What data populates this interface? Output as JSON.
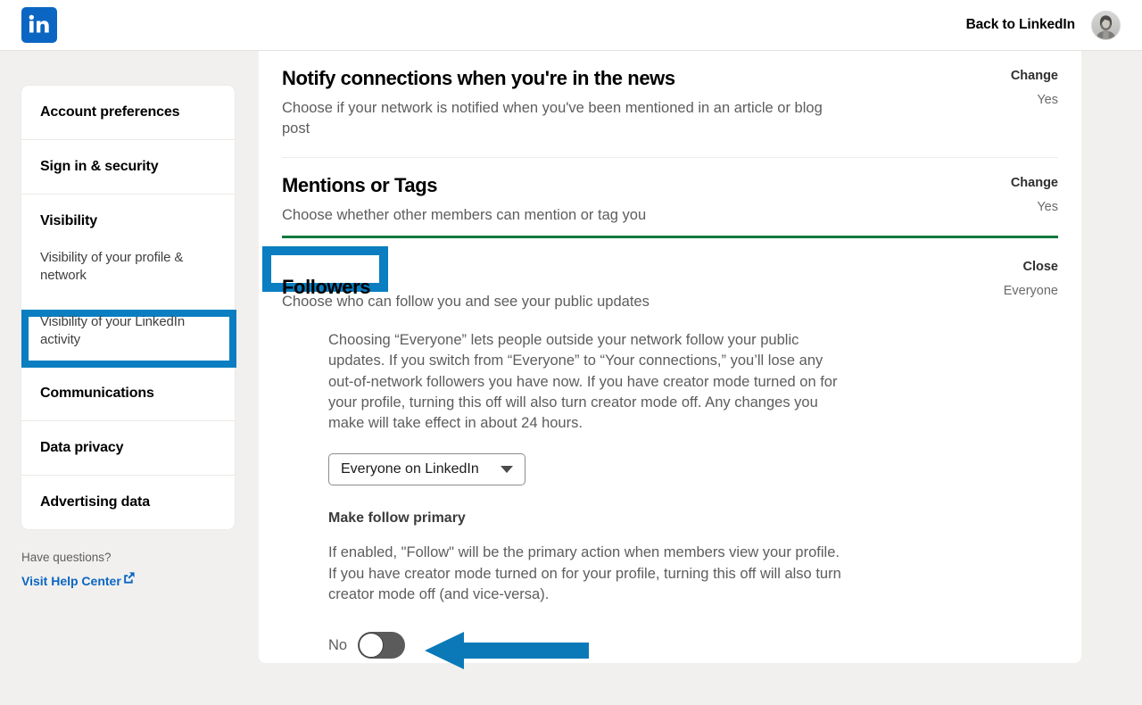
{
  "header": {
    "logo_icon": "linkedin-logo-icon",
    "back_label": "Back to LinkedIn",
    "avatar_icon": "user-avatar"
  },
  "sidebar": {
    "items": [
      {
        "label": "Account preferences",
        "type": "primary"
      },
      {
        "label": "Sign in & security",
        "type": "primary"
      },
      {
        "label": "Visibility",
        "type": "primary"
      },
      {
        "label": "Visibility of your profile & network",
        "type": "sub"
      },
      {
        "label": "Visibility of your LinkedIn activity",
        "type": "sub",
        "highlighted": true
      },
      {
        "label": "Communications",
        "type": "primary"
      },
      {
        "label": "Data privacy",
        "type": "primary"
      },
      {
        "label": "Advertising data",
        "type": "primary"
      }
    ],
    "help_question": "Have questions?",
    "help_link": "Visit Help Center",
    "help_link_icon": "external-link-icon"
  },
  "main": {
    "settings": [
      {
        "title": "Notify connections when you're in the news",
        "description": "Choose if your network is notified when you've been mentioned in an article or blog post",
        "action": "Change",
        "value": "Yes"
      },
      {
        "title": "Mentions or Tags",
        "description": "Choose whether other members can mention or tag you",
        "action": "Change",
        "value": "Yes"
      }
    ],
    "followers": {
      "title": "Followers",
      "description": "Choose who can follow you and see your public updates",
      "action": "Close",
      "value": "Everyone",
      "body_paragraph": "Choosing “Everyone” lets people outside your network follow your public updates. If you switch from “Everyone” to “Your connections,” you’ll lose any out-of-network followers you have now. If you have creator mode turned on for your profile, turning this off will also turn creator mode off. Any changes you make will take effect in about 24 hours.",
      "select_value": "Everyone on LinkedIn",
      "select_caret_icon": "chevron-down-icon",
      "sub_heading": "Make follow primary",
      "sub_paragraph": "If enabled, \"Follow\" will be the primary action when members view your profile. If you have creator mode turned on for your profile, turning this off will also turn creator mode off (and vice-versa).",
      "toggle_label": "No",
      "toggle_state": "off"
    }
  },
  "annotations": {
    "highlight_color": "#0a7ec0",
    "arrow_color": "#0b79b8",
    "arrow_icon": "left-arrow-annotation",
    "divider_color": "#0a7a3d"
  }
}
